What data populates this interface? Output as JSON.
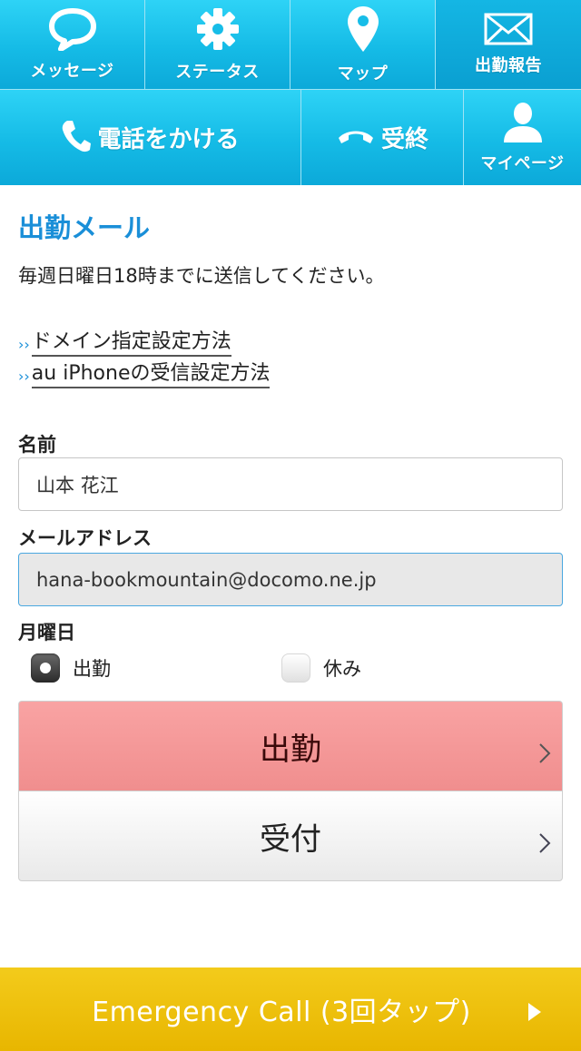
{
  "nav": {
    "messages_label": "メッセージ",
    "status_label": "ステータス",
    "map_label": "マップ",
    "report_label": "出勤報告",
    "call_label": "電話をかける",
    "hangup_label": "受終",
    "mypage_label": "マイページ"
  },
  "main": {
    "title": "出勤メール",
    "instruction": "毎週日曜日18時までに送信してください。",
    "links": [
      {
        "label": "ドメイン指定設定方法"
      },
      {
        "label": "au iPhoneの受信設定方法"
      }
    ],
    "link_marker": "››"
  },
  "form": {
    "name_label": "名前",
    "name_value": "山本 花江",
    "email_label": "メールアドレス",
    "email_value": "hana-bookmountain@docomo.ne.jp",
    "day_label": "月曜日",
    "options": [
      {
        "label": "出勤",
        "selected": true
      },
      {
        "label": "休み",
        "selected": false
      }
    ]
  },
  "choices": {
    "work_label": "出勤",
    "reception_label": "受付"
  },
  "emergency": {
    "label": "Emergency Call (3回タップ)"
  },
  "colors": {
    "nav": "#15bbe6",
    "accent": "#1a8fd8",
    "work_button": "#f08e8e",
    "emergency": "#e8b600"
  }
}
